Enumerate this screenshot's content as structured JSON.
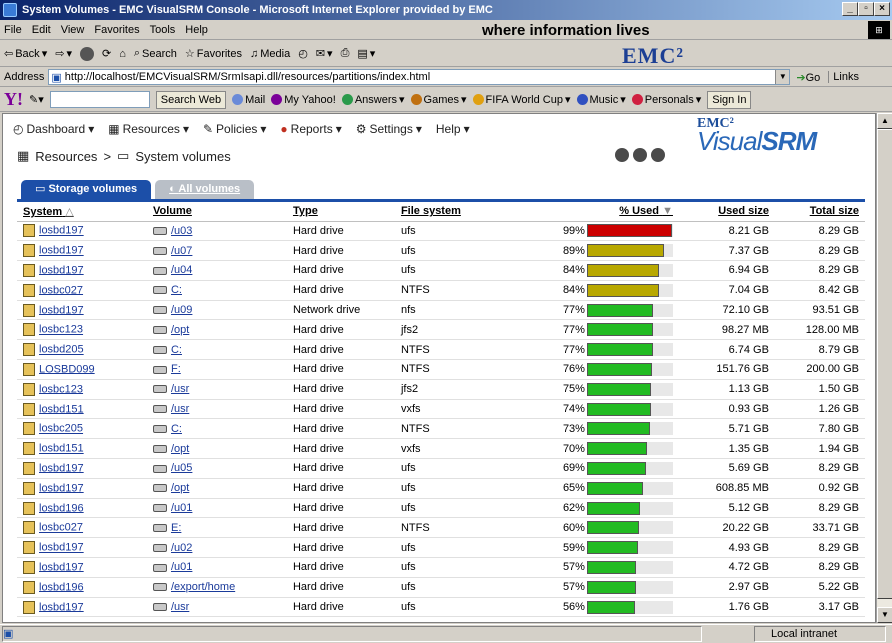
{
  "window": {
    "title": "System Volumes - EMC VisualSRM Console - Microsoft Internet Explorer provided by EMC",
    "tagline": "where information lives",
    "brand": "EMC²"
  },
  "menu": [
    "File",
    "Edit",
    "View",
    "Favorites",
    "Tools",
    "Help"
  ],
  "toolbar": {
    "back": "Back",
    "search": "Search",
    "favorites": "Favorites",
    "media": "Media"
  },
  "address": {
    "label": "Address",
    "url": "http://localhost/EMCVisualSRM/SrmIsapi.dll/resources/partitions/index.html",
    "go": "Go",
    "links": "Links"
  },
  "yahoo": {
    "logo": "Y!",
    "search_btn": "Search Web",
    "items": [
      "Mail",
      "My Yahoo!",
      "Answers",
      "Games",
      "FIFA World Cup",
      "Music",
      "Personals"
    ],
    "signin": "Sign In"
  },
  "appnav": [
    "Dashboard",
    "Resources",
    "Policies",
    "Reports",
    "Settings",
    "Help"
  ],
  "product": {
    "emc": "EMC²",
    "name_a": "Visual",
    "name_b": "SRM"
  },
  "breadcrumb": {
    "root": "Resources",
    "sep": ">",
    "current": "System volumes"
  },
  "tabs": {
    "active": "Storage volumes",
    "inactive": "All volumes"
  },
  "table": {
    "headers": {
      "system": "System",
      "volume": "Volume",
      "type": "Type",
      "fs": "File system",
      "used_pct": "% Used",
      "used": "Used size",
      "total": "Total size"
    },
    "rows": [
      {
        "system": "losbd197",
        "volume": "/u03",
        "type": "Hard drive",
        "fs": "ufs",
        "pct": 99,
        "pct_label": "99%",
        "used": "8.21 GB",
        "total": "8.29 GB",
        "color": "#cc0000"
      },
      {
        "system": "losbd197",
        "volume": "/u07",
        "type": "Hard drive",
        "fs": "ufs",
        "pct": 89,
        "pct_label": "89%",
        "used": "7.37 GB",
        "total": "8.29 GB",
        "color": "#b8a800"
      },
      {
        "system": "losbd197",
        "volume": "/u04",
        "type": "Hard drive",
        "fs": "ufs",
        "pct": 84,
        "pct_label": "84%",
        "used": "6.94 GB",
        "total": "8.29 GB",
        "color": "#b8a800"
      },
      {
        "system": "losbc027",
        "volume": "C:",
        "type": "Hard drive",
        "fs": "NTFS",
        "pct": 84,
        "pct_label": "84%",
        "used": "7.04 GB",
        "total": "8.42 GB",
        "color": "#b8a800"
      },
      {
        "system": "losbd197",
        "volume": "/u09",
        "type": "Network drive",
        "fs": "nfs",
        "pct": 77,
        "pct_label": "77%",
        "used": "72.10 GB",
        "total": "93.51 GB",
        "color": "#22bb22"
      },
      {
        "system": "losbc123",
        "volume": "/opt",
        "type": "Hard drive",
        "fs": "jfs2",
        "pct": 77,
        "pct_label": "77%",
        "used": "98.27 MB",
        "total": "128.00 MB",
        "color": "#22bb22"
      },
      {
        "system": "losbd205",
        "volume": "C:",
        "type": "Hard drive",
        "fs": "NTFS",
        "pct": 77,
        "pct_label": "77%",
        "used": "6.74 GB",
        "total": "8.79 GB",
        "color": "#22bb22"
      },
      {
        "system": "LOSBD099",
        "volume": "F:",
        "type": "Hard drive",
        "fs": "NTFS",
        "pct": 76,
        "pct_label": "76%",
        "used": "151.76 GB",
        "total": "200.00 GB",
        "color": "#22bb22"
      },
      {
        "system": "losbc123",
        "volume": "/usr",
        "type": "Hard drive",
        "fs": "jfs2",
        "pct": 75,
        "pct_label": "75%",
        "used": "1.13 GB",
        "total": "1.50 GB",
        "color": "#22bb22"
      },
      {
        "system": "losbd151",
        "volume": "/usr",
        "type": "Hard drive",
        "fs": "vxfs",
        "pct": 74,
        "pct_label": "74%",
        "used": "0.93 GB",
        "total": "1.26 GB",
        "color": "#22bb22"
      },
      {
        "system": "losbc205",
        "volume": "C:",
        "type": "Hard drive",
        "fs": "NTFS",
        "pct": 73,
        "pct_label": "73%",
        "used": "5.71 GB",
        "total": "7.80 GB",
        "color": "#22bb22"
      },
      {
        "system": "losbd151",
        "volume": "/opt",
        "type": "Hard drive",
        "fs": "vxfs",
        "pct": 70,
        "pct_label": "70%",
        "used": "1.35 GB",
        "total": "1.94 GB",
        "color": "#22bb22"
      },
      {
        "system": "losbd197",
        "volume": "/u05",
        "type": "Hard drive",
        "fs": "ufs",
        "pct": 69,
        "pct_label": "69%",
        "used": "5.69 GB",
        "total": "8.29 GB",
        "color": "#22bb22"
      },
      {
        "system": "losbd197",
        "volume": "/opt",
        "type": "Hard drive",
        "fs": "ufs",
        "pct": 65,
        "pct_label": "65%",
        "used": "608.85 MB",
        "total": "0.92 GB",
        "color": "#22bb22"
      },
      {
        "system": "losbd196",
        "volume": "/u01",
        "type": "Hard drive",
        "fs": "ufs",
        "pct": 62,
        "pct_label": "62%",
        "used": "5.12 GB",
        "total": "8.29 GB",
        "color": "#22bb22"
      },
      {
        "system": "losbc027",
        "volume": "E:",
        "type": "Hard drive",
        "fs": "NTFS",
        "pct": 60,
        "pct_label": "60%",
        "used": "20.22 GB",
        "total": "33.71 GB",
        "color": "#22bb22"
      },
      {
        "system": "losbd197",
        "volume": "/u02",
        "type": "Hard drive",
        "fs": "ufs",
        "pct": 59,
        "pct_label": "59%",
        "used": "4.93 GB",
        "total": "8.29 GB",
        "color": "#22bb22"
      },
      {
        "system": "losbd197",
        "volume": "/u01",
        "type": "Hard drive",
        "fs": "ufs",
        "pct": 57,
        "pct_label": "57%",
        "used": "4.72 GB",
        "total": "8.29 GB",
        "color": "#22bb22"
      },
      {
        "system": "losbd196",
        "volume": "/export/home",
        "type": "Hard drive",
        "fs": "ufs",
        "pct": 57,
        "pct_label": "57%",
        "used": "2.97 GB",
        "total": "5.22 GB",
        "color": "#22bb22"
      },
      {
        "system": "losbd197",
        "volume": "/usr",
        "type": "Hard drive",
        "fs": "ufs",
        "pct": 56,
        "pct_label": "56%",
        "used": "1.76 GB",
        "total": "3.17 GB",
        "color": "#22bb22"
      }
    ]
  },
  "status": {
    "zone": "Local intranet"
  }
}
